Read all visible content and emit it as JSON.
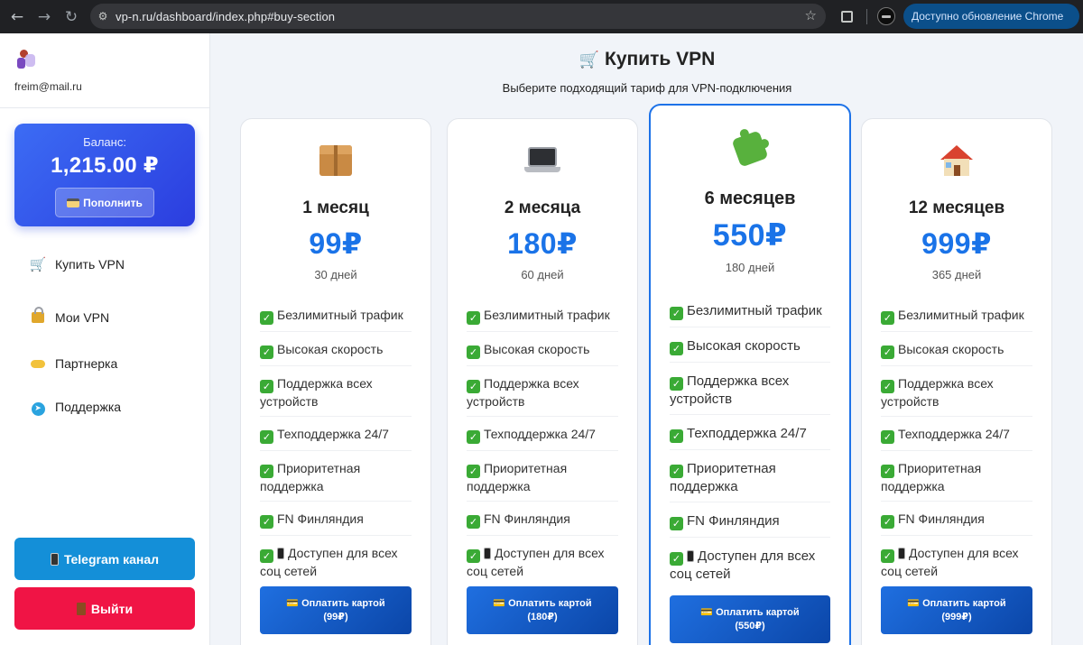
{
  "browser": {
    "url": "vp-n.ru/dashboard/index.php#buy-section",
    "update_label": "Доступно обновление Chrome"
  },
  "sidebar": {
    "email": "freim@mail.ru",
    "balance_label": "Баланс:",
    "balance_value": "1,215.00 ₽",
    "topup_label": "Пополнить",
    "menu": [
      {
        "label": "Купить VPN",
        "icon": "shopping-cart-icon"
      },
      {
        "label": "Мои VPN",
        "icon": "lock-icon"
      },
      {
        "label": "Партнерка",
        "icon": "handshake-icon"
      },
      {
        "label": "Поддержка",
        "icon": "telegram-icon"
      }
    ],
    "telegram_label": "Telegram канал",
    "logout_label": "Выйти"
  },
  "main": {
    "title": "Купить VPN",
    "subtitle": "Выберите подходящий тариф для VPN-подключения"
  },
  "plans": [
    {
      "name": "1 месяц",
      "price": "99₽",
      "days": "30 дней",
      "icon": "package-icon",
      "features": [
        "Безлимитный трафик",
        "Высокая скорость",
        "Поддержка всех устройств",
        "Техподдержка 24/7",
        "Приоритетная поддержка",
        "FN Финляндия",
        "Доступен для всех соц сетей"
      ],
      "pay_label": "Оплатить картой",
      "pay_amount": "(99₽)"
    },
    {
      "name": "2 месяца",
      "price": "180₽",
      "days": "60 дней",
      "icon": "laptop-icon",
      "features": [
        "Безлимитный трафик",
        "Высокая скорость",
        "Поддержка всех устройств",
        "Техподдержка 24/7",
        "Приоритетная поддержка",
        "FN Финляндия",
        "Доступен для всех соц сетей"
      ],
      "pay_label": "Оплатить картой",
      "pay_amount": "(180₽)"
    },
    {
      "name": "6 месяцев",
      "price": "550₽",
      "days": "180 дней",
      "icon": "puzzle-icon",
      "features": [
        "Безлимитный трафик",
        "Высокая скорость",
        "Поддержка всех устройств",
        "Техподдержка 24/7",
        "Приоритетная поддержка",
        "FN Финляндия",
        "Доступен для всех соц сетей"
      ],
      "pay_label": "Оплатить картой",
      "pay_amount": "(550₽)"
    },
    {
      "name": "12 месяцев",
      "price": "999₽",
      "days": "365 дней",
      "icon": "house-icon",
      "features": [
        "Безлимитный трафик",
        "Высокая скорость",
        "Поддержка всех устройств",
        "Техподдержка 24/7",
        "Приоритетная поддержка",
        "FN Финляндия",
        "Доступен для всех соц сетей"
      ],
      "pay_label": "Оплатить картой",
      "pay_amount": "(999₽)"
    }
  ],
  "colors": {
    "accent": "#1a73e8",
    "balance_card": "#3554ea",
    "telegram_button": "#148fd8",
    "logout_button": "#f01445",
    "check": "#3aaa35"
  }
}
